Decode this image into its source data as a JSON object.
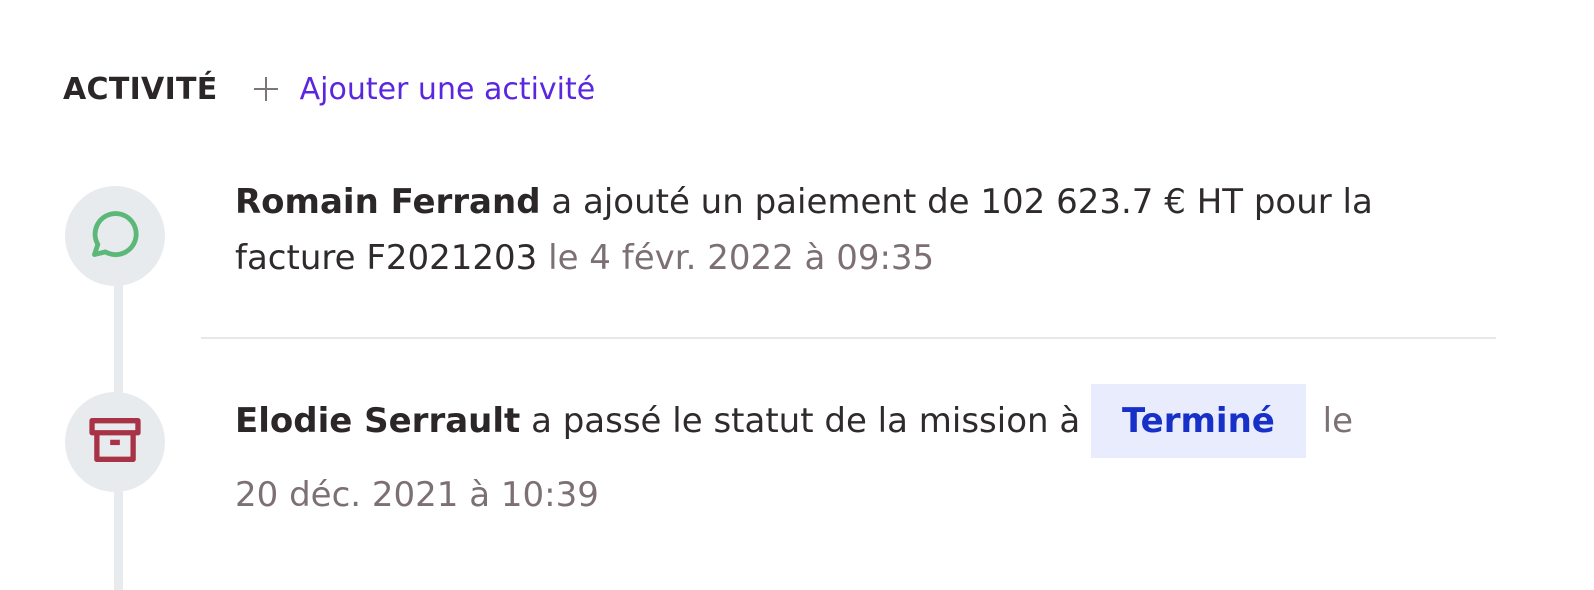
{
  "activity": {
    "title": "ACTIVITÉ",
    "add_label": "Ajouter une activité"
  },
  "entries": [
    {
      "icon": "chat-bubble-icon",
      "icon_color": "#5cb879",
      "author": "Romain Ferrand",
      "text": " a ajouté un paiement de 102 623.7 € HT pour la facture F2021203 ",
      "date": "le 4 févr. 2022 à 09:35"
    },
    {
      "icon": "archive-box-icon",
      "icon_color": "#a83246",
      "author": "Elodie Serrault",
      "text": " a passé le statut de la mission à ",
      "status": "Terminé",
      "date_prefix": "le",
      "date": "20 déc. 2021 à 10:39"
    }
  ],
  "colors": {
    "accent": "#5a26e0",
    "badge_bg": "#e8ecfd",
    "badge_text": "#1730c8",
    "date_text": "#7d7074"
  }
}
